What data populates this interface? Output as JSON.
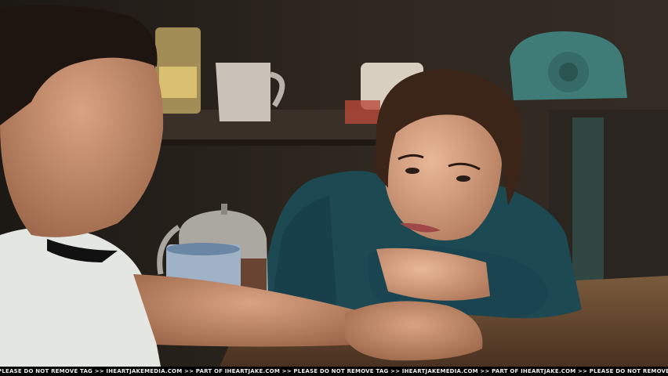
{
  "photo": {
    "watermark_text": "PLEASE DO NOT REMOVE TAG >> IHEARTJAKEMEDIA.COM >> PART OF IHEARTJAKE.COM >> PLEASE DO NOT REMOVE TAG >> IHEARTJAKEMEDIA.COM >> PART OF IHEARTJAKE.COM >> PLEASE DO NOT REMOVE TAG >> IHEARTJAKEMEDIA.COM >> PART OF IHEARTJAKE.COM >> PLEASE DO NOT REMOVE TAG >> IHEARTJAKE"
  },
  "colors": {
    "background": "#2a231c",
    "shirt_white": "#e4e6e2",
    "sweater_teal": "#1d4a52",
    "table_wood": "#6b4a30",
    "phone_teal": "#3f7c78"
  }
}
